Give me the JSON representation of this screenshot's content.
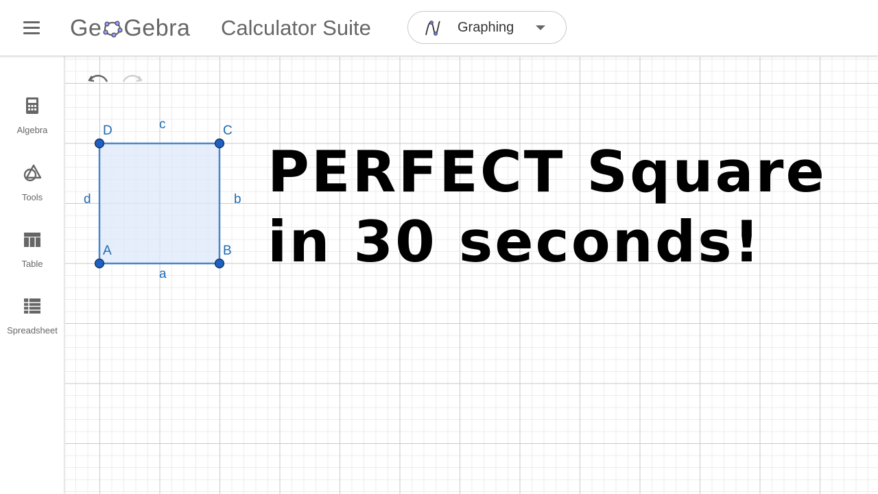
{
  "header": {
    "logo_text_left": "Ge",
    "logo_text_right": "Gebra",
    "suite_title": "Calculator Suite",
    "app_picker": {
      "label": "Graphing",
      "icon": "graphing-curve-icon"
    }
  },
  "sidebar": {
    "items": [
      {
        "label": "Algebra",
        "icon": "calculator-icon"
      },
      {
        "label": "Tools",
        "icon": "tools-shapes-icon"
      },
      {
        "label": "Table",
        "icon": "table-icon"
      },
      {
        "label": "Spreadsheet",
        "icon": "spreadsheet-icon"
      }
    ]
  },
  "toolbar": {
    "undo_icon": "undo-icon",
    "redo_icon": "redo-icon"
  },
  "graphics": {
    "points": {
      "A": "A",
      "B": "B",
      "C": "C",
      "D": "D"
    },
    "segments": {
      "a": "a",
      "b": "b",
      "c": "c",
      "d": "d"
    },
    "colors": {
      "point": "#1f5fbf",
      "segment": "#4a86c8",
      "fill": "#dce8f8",
      "label": "#1f6ab0"
    }
  },
  "headline": {
    "line1": "PERFECT Square",
    "line2": "in 30 seconds!"
  }
}
